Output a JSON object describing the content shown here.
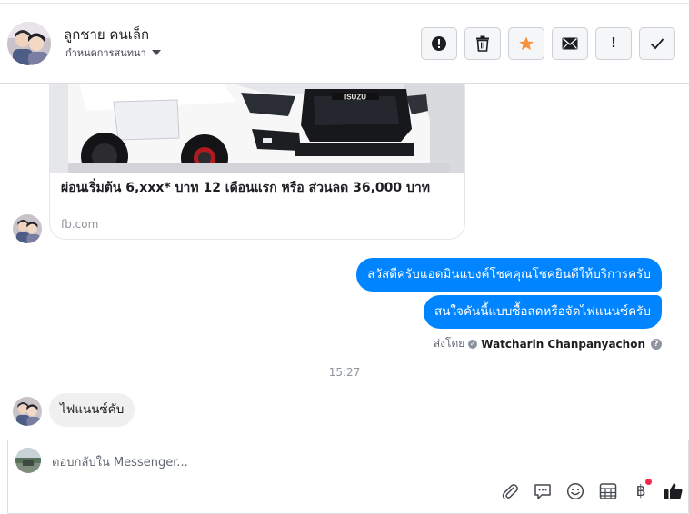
{
  "header": {
    "name": "ลูกชาย คนเล็ก",
    "subtitle": "กำหนดการสนทนา",
    "actions": [
      {
        "icon": "alert-circle-icon",
        "label": ""
      },
      {
        "icon": "trash-icon",
        "label": ""
      },
      {
        "icon": "star-icon",
        "label": ""
      },
      {
        "icon": "envelope-icon",
        "label": ""
      },
      {
        "icon": "exclamation-icon",
        "label": "!"
      },
      {
        "icon": "check-icon",
        "label": ""
      }
    ]
  },
  "link_card": {
    "title": "ผ่อนเริ่มต้น 6,xxx* บาท 12 เดือนแรก หรือ ส่วนลด 36,000 บาท",
    "domain": "fb.com",
    "image_brand": "ISUZU"
  },
  "messages_out": [
    "สวัสดีครับแอดมินแบงค์โชคคุณโชคยินดีให้บริการครับ",
    "สนใจคันนี้แบบซื้อสดหรือจัดไฟแนนซ์ครับ"
  ],
  "sent_by": {
    "prefix": "ส่งโดย",
    "name": "Watcharin Chanpanyachon",
    "help": "?"
  },
  "timestamp": "15:27",
  "message_in": "ไฟแนนซ์คับ",
  "composer": {
    "placeholder": "ตอบกลับใน Messenger...",
    "tools": [
      "attachment-icon",
      "saved-reply-icon",
      "emoji-icon",
      "table-icon",
      "baht-icon",
      "thumbs-up-icon"
    ],
    "baht_symbol": "฿"
  },
  "colors": {
    "accent": "#0084ff",
    "star": "#f7923b",
    "incoming_bubble": "#f1f0f0",
    "notification_dot": "#f02849"
  }
}
